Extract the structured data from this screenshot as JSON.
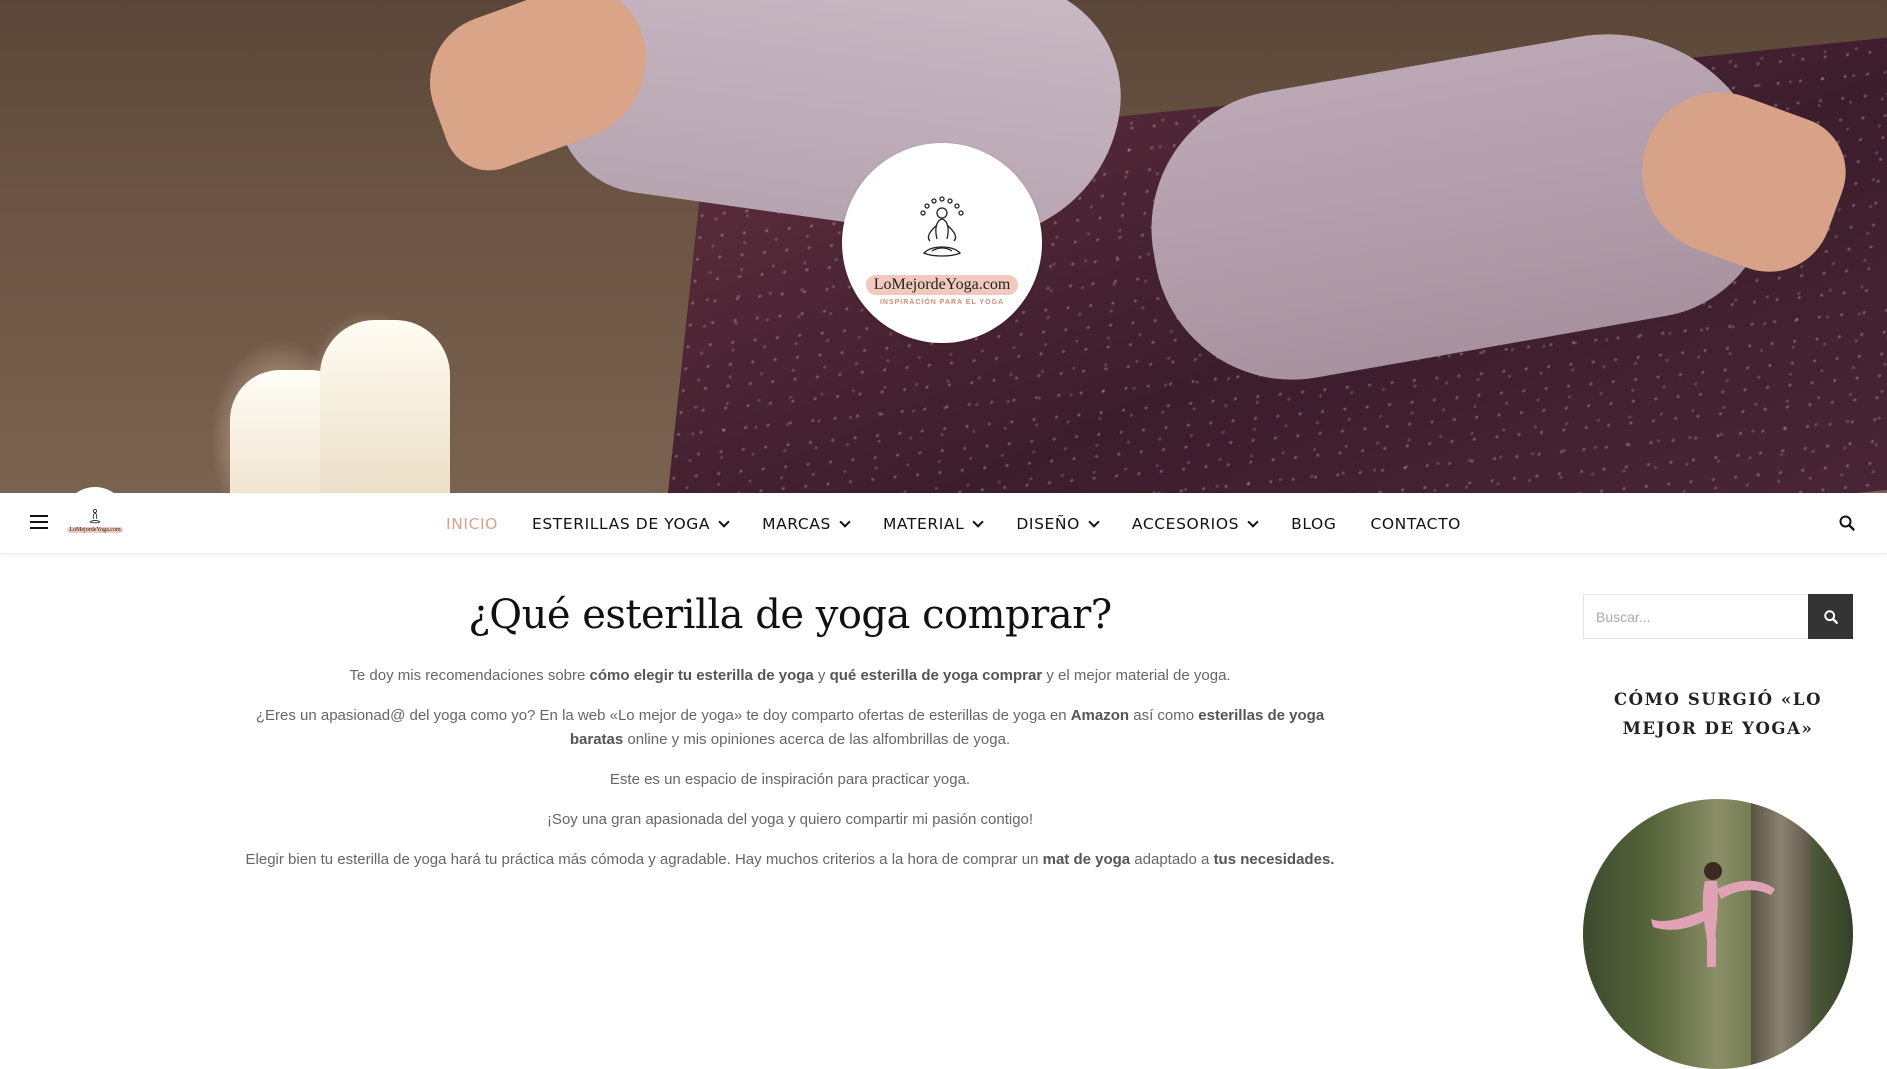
{
  "site": {
    "logo_name": "LoMejordeYoga.com",
    "logo_tagline": "INSPIRACIÓN PARA EL YOGA"
  },
  "nav": {
    "items": [
      {
        "label": "INICIO",
        "active": true,
        "dropdown": false
      },
      {
        "label": "ESTERILLAS DE YOGA",
        "active": false,
        "dropdown": true
      },
      {
        "label": "MARCAS",
        "active": false,
        "dropdown": true
      },
      {
        "label": "MATERIAL",
        "active": false,
        "dropdown": true
      },
      {
        "label": "DISEÑO",
        "active": false,
        "dropdown": true
      },
      {
        "label": "ACCESORIOS",
        "active": false,
        "dropdown": true
      },
      {
        "label": "BLOG",
        "active": false,
        "dropdown": false
      },
      {
        "label": "CONTACTO",
        "active": false,
        "dropdown": false
      }
    ],
    "active_color": "#d9a08c",
    "icons": {
      "menu": "hamburger-icon",
      "search": "search-icon",
      "dropdown": "chevron-down-icon"
    }
  },
  "main": {
    "title": "¿Qué esterilla de yoga comprar?",
    "paragraphs": {
      "p1": {
        "t1": "Te doy mis recomendaciones sobre ",
        "b1": "cómo elegir tu esterilla de yoga",
        "t2": " y ",
        "b2": "qué esterilla de yoga comprar",
        "t3": " y el mejor material de yoga."
      },
      "p2": {
        "t1": "¿Eres un apasionad@ del yoga como yo? En la web «Lo mejor de yoga» te doy comparto ofertas de esterillas de yoga en ",
        "b1": "Amazon",
        "t2": " así como ",
        "b2": "esterillas de yoga baratas",
        "t3": " online y mis opiniones acerca de las alfombrillas de yoga."
      },
      "p3": "Este es un espacio de inspiración para practicar yoga.",
      "p4": "¡Soy una gran apasionada del yoga y quiero compartir mi pasión contigo!",
      "p5": {
        "t1": "Elegir bien tu esterilla de yoga hará tu práctica más cómoda y agradable. Hay muchos criterios a la hora de comprar un ",
        "b1": "mat de yoga",
        "t2": " adaptado a ",
        "b2": "tus necesidades."
      }
    }
  },
  "sidebar": {
    "search_placeholder": "Buscar...",
    "widget_title": "CÓMO SURGIÓ «LO MEJOR DE YOGA»"
  },
  "colors": {
    "accent": "#d9a08c",
    "logo_pill": "#f2c9bd",
    "search_button": "#333333"
  }
}
